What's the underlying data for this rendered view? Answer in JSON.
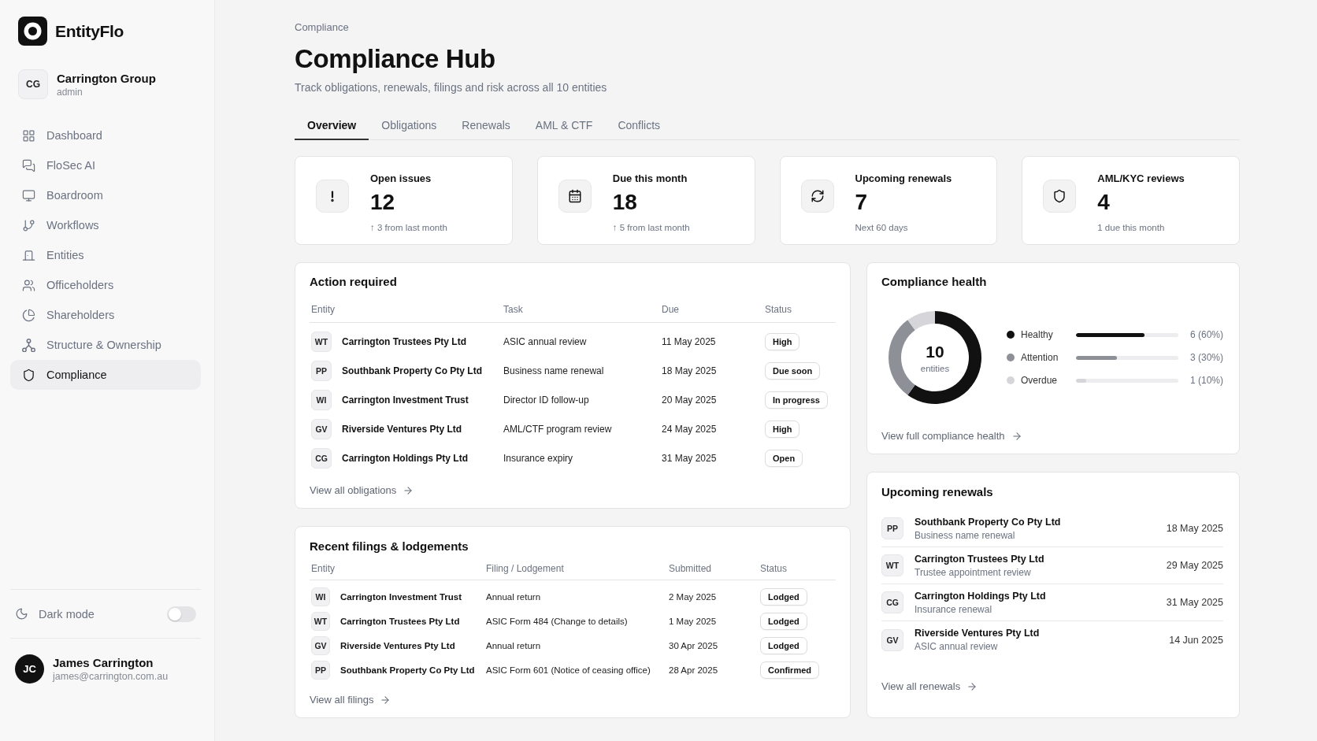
{
  "sidebar": {
    "brand": "EntityFlo",
    "org": {
      "initials": "CG",
      "name": "Carrington Group",
      "role": "admin"
    },
    "nav": [
      {
        "label": "Dashboard",
        "selected": false
      },
      {
        "label": "FloSec AI",
        "selected": false
      },
      {
        "label": "Boardroom",
        "selected": false
      },
      {
        "label": "Workflows",
        "selected": false
      },
      {
        "label": "Entities",
        "selected": false
      },
      {
        "label": "Officeholders",
        "selected": false
      },
      {
        "label": "Shareholders",
        "selected": false
      },
      {
        "label": "Structure & Ownership",
        "selected": false
      },
      {
        "label": "Compliance",
        "selected": true
      }
    ],
    "dark_mode": {
      "label": "Dark mode",
      "on": false
    },
    "user": {
      "initials": "JC",
      "name": "James Carrington",
      "email": "james@carrington.com.au"
    }
  },
  "header": {
    "breadcrumb": "Compliance",
    "title": "Compliance Hub",
    "subtitle": "Track obligations, renewals, filings and risk across all 10 entities"
  },
  "tabs": [
    {
      "label": "Overview",
      "selected": true
    },
    {
      "label": "Obligations",
      "selected": false
    },
    {
      "label": "Renewals",
      "selected": false
    },
    {
      "label": "AML & CTF",
      "selected": false
    },
    {
      "label": "Conflicts",
      "selected": false
    }
  ],
  "stats": [
    {
      "label": "Open issues",
      "value": "12",
      "note": "↑ 3 from last month"
    },
    {
      "label": "Due this month",
      "value": "18",
      "note": "↑ 5 from last month"
    },
    {
      "label": "Upcoming renewals",
      "value": "7",
      "note": "Next 60 days"
    },
    {
      "label": "AML/KYC reviews",
      "value": "4",
      "note": "1 due this month"
    }
  ],
  "action_required": {
    "title": "Action required",
    "columns": [
      "Entity",
      "Task",
      "Due",
      "Status"
    ],
    "rows": [
      {
        "initials": "WT",
        "entity": "Carrington Trustees Pty Ltd",
        "task": "ASIC annual review",
        "due": "11 May 2025",
        "status": "High"
      },
      {
        "initials": "PP",
        "entity": "Southbank Property Co Pty Ltd",
        "task": "Business name renewal",
        "due": "18 May 2025",
        "status": "Due soon"
      },
      {
        "initials": "WI",
        "entity": "Carrington Investment Trust",
        "task": "Director ID follow-up",
        "due": "20 May 2025",
        "status": "In progress"
      },
      {
        "initials": "GV",
        "entity": "Riverside Ventures Pty Ltd",
        "task": "AML/CTF program review",
        "due": "24 May 2025",
        "status": "High"
      },
      {
        "initials": "CG",
        "entity": "Carrington Holdings Pty Ltd",
        "task": "Insurance expiry",
        "due": "31 May 2025",
        "status": "Open"
      }
    ],
    "link": "View all obligations"
  },
  "recent_filings": {
    "title": "Recent filings & lodgements",
    "columns": [
      "Entity",
      "Filing / Lodgement",
      "Submitted",
      "Status"
    ],
    "rows": [
      {
        "initials": "WI",
        "entity": "Carrington Investment Trust",
        "filing": "Annual return",
        "submitted": "2 May 2025",
        "status": "Lodged"
      },
      {
        "initials": "WT",
        "entity": "Carrington Trustees Pty Ltd",
        "filing": "ASIC Form 484 (Change to details)",
        "submitted": "1 May 2025",
        "status": "Lodged"
      },
      {
        "initials": "GV",
        "entity": "Riverside Ventures Pty Ltd",
        "filing": "Annual return",
        "submitted": "30 Apr 2025",
        "status": "Lodged"
      },
      {
        "initials": "PP",
        "entity": "Southbank Property Co Pty Ltd",
        "filing": "ASIC Form 601 (Notice of ceasing office)",
        "submitted": "28 Apr 2025",
        "status": "Confirmed"
      }
    ],
    "link": "View all filings"
  },
  "compliance_health": {
    "title": "Compliance health",
    "total": "10",
    "total_label": "entities",
    "chart_data": {
      "type": "donut",
      "values": [
        60,
        30,
        10
      ]
    },
    "legend": [
      {
        "label": "Healthy",
        "value": "6 (60%)",
        "level": 0.67,
        "color": "#111111"
      },
      {
        "label": "Attention",
        "value": "3 (30%)",
        "level": 0.4,
        "color": "#8e9097"
      },
      {
        "label": "Overdue",
        "value": "1 (10%)",
        "level": 0.1,
        "color": "#d6d6da"
      }
    ],
    "link": "View full compliance health"
  },
  "upcoming_renewals": {
    "title": "Upcoming renewals",
    "items": [
      {
        "initials": "PP",
        "entity": "Southbank Property Co Pty Ltd",
        "task": "Business name renewal",
        "date": "18 May 2025"
      },
      {
        "initials": "WT",
        "entity": "Carrington Trustees Pty Ltd",
        "task": "Trustee appointment review",
        "date": "29 May 2025"
      },
      {
        "initials": "CG",
        "entity": "Carrington Holdings Pty Ltd",
        "task": "Insurance renewal",
        "date": "31 May 2025"
      },
      {
        "initials": "GV",
        "entity": "Riverside Ventures Pty Ltd",
        "task": "ASIC annual review",
        "date": "14 Jun 2025"
      }
    ],
    "link": "View all renewals"
  }
}
